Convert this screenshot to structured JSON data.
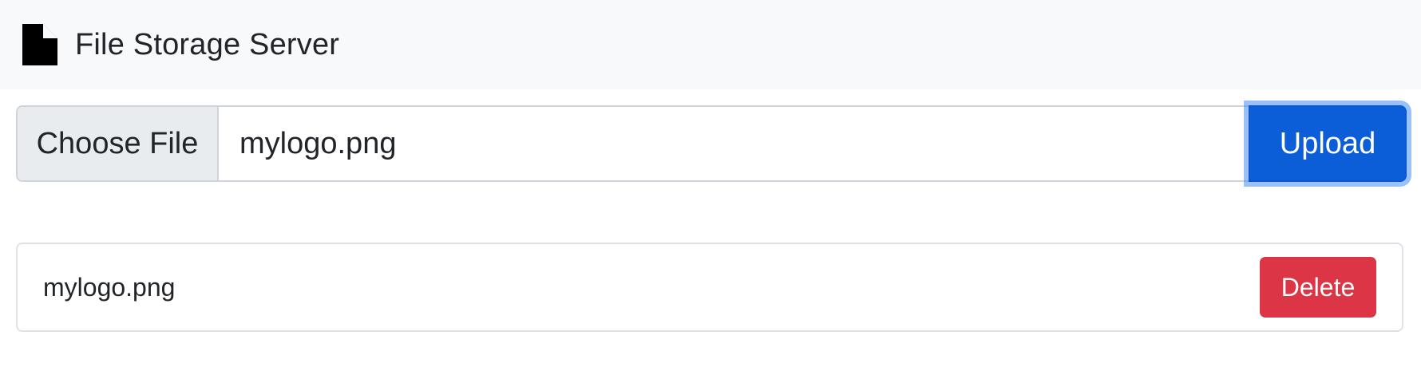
{
  "navbar": {
    "brand_icon": "file-icon",
    "title": "File Storage Server"
  },
  "upload_form": {
    "choose_label": "Choose File",
    "selected_file": "mylogo.png",
    "upload_label": "Upload",
    "upload_color": "#0b5ed7"
  },
  "files": [
    {
      "name": "mylogo.png",
      "delete_label": "Delete",
      "delete_color": "#dc3545"
    }
  ]
}
